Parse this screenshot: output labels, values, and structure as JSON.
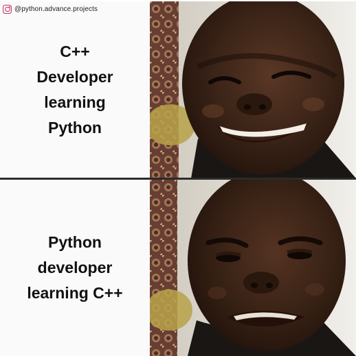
{
  "credit": {
    "icon": "instagram-icon",
    "handle": "@python.advance.projects"
  },
  "panels": [
    {
      "caption": "C++\nDeveloper\nlearning\nPython",
      "expression": "smiling"
    },
    {
      "caption": "Python\ndeveloper\nlearning C++",
      "expression": "disappointed"
    }
  ],
  "colors": {
    "skin": "#3b2418",
    "background_wall": "#e8e6e2",
    "curtain": "#6b3a2a",
    "shirt": "#1a1614"
  }
}
